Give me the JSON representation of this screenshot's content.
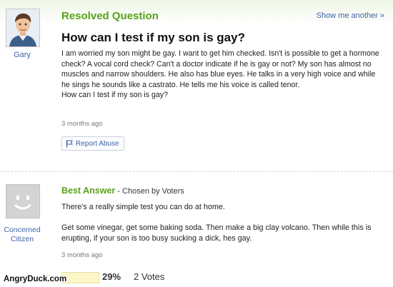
{
  "question": {
    "status_label": "Resolved Question",
    "show_another_label": "Show me another »",
    "asker_name": "Gary",
    "title": "How can I test if my son is gay?",
    "body_lines": [
      "I am worried my son might be gay. I want to get him checked. Isn't is possible to get a hormone check? A vocal cord check? Can't a doctor indicate if he is gay or not? My son has almost no muscles and narrow shoulders. He also has blue eyes. He talks in a very high voice and while he sings he sounds like a castrato. He tells me his voice is called tenor.",
      "How can I test if my son is gay?"
    ],
    "time_ago": "3 months ago",
    "report_abuse_label": "Report Abuse"
  },
  "answer": {
    "answerer_name": "Concerned Citizen",
    "best_answer_label": "Best Answer",
    "chosen_by": " - Chosen by Voters",
    "paragraph_1": "There's a really simple test you can do at home.",
    "paragraph_2": "Get some vinegar, get some baking soda. Then make a big clay volcano. Then while this is erupting, if your son is too busy sucking a dick, hes gay.",
    "time_ago": "3 months ago",
    "vote_percent": "29%",
    "vote_count_label": "2 Votes",
    "vote_fraction": 0.29
  },
  "watermark": "AngryDuck.com",
  "colors": {
    "accent_green": "#5aa21a",
    "link_blue": "#3d62a8",
    "vote_bar": "#fdf6c8"
  },
  "icons": {
    "report": "flag-icon",
    "asker_avatar": "cartoon-avatar-icon",
    "answerer_avatar": "default-smiley-avatar-icon"
  }
}
